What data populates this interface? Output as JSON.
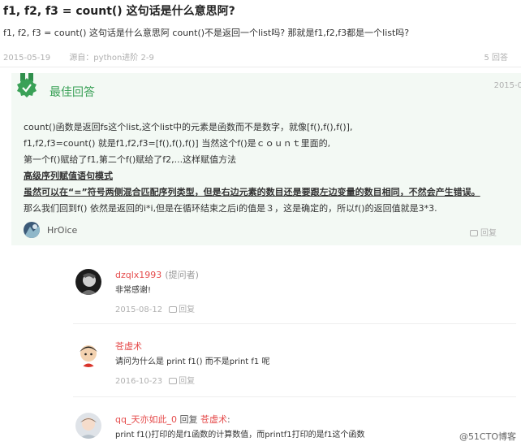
{
  "question": {
    "title": "f1, f2, f3 = count() 这句话是什么意思阿?",
    "description": "f1, f2, f3 = count() 这句话是什么意思阿   count()不是返回一个list吗?   那就是f1,f2,f3都是一个list吗?",
    "date": "2015-05-19",
    "source": "源自：python进阶 2-9",
    "answer_count": "5 回答"
  },
  "best_answer": {
    "label": "最佳回答",
    "date": "2015-0",
    "lines": [
      "count()函数是返回fs这个list,这个list中的元素是函数而不是数字，就像[f(),f(),f()],",
      "f1,f2,f3=count()  就是f1,f2,f3=[f(),f(),f()]    当然这个f()是ｃｏｕｎｔ里面的,",
      "第一个f()赋给了f1,第二个f()赋给了f2,...这样赋值方法",
      "高级序列赋值语句模式",
      "虽然可以在“=”符号两侧混合匹配序列类型，但是右边元素的数目还是要跟左边变量的数目相同，不然会产生错误。",
      "那么我们回到f()        依然是返回的i*i,但是在循环结束之后i的值是３，这是确定的，所以f()的返回值就是3*3."
    ],
    "user": "HrOice",
    "reply_label": "回复"
  },
  "comments": [
    {
      "name": "dzqlx1993",
      "role": "(提问者)",
      "text": "非常感谢!",
      "date": "2015-08-12",
      "reply_label": "回复"
    },
    {
      "name": "苍虚术",
      "text": "请问为什么是 print f1() 而不是print f1 呢",
      "date": "2016-10-23",
      "reply_label": "回复"
    },
    {
      "name": "qq_天亦如此_0",
      "reply_word": "回复",
      "reply_to": "苍虚术",
      "colon": ":",
      "text": "print f1()打印的是f1函数的计算数值，而printf1打印的是f1这个函数"
    }
  ],
  "watermark": "@51CTO博客",
  "colors": {
    "accent_green": "#3aa157",
    "best_bg": "#f3f9f4",
    "username_red": "#e54b4b",
    "meta_gray": "#b0b0b0"
  },
  "icons": [
    "best-answer-badge-icon",
    "reply-icon",
    "avatar-hroice",
    "avatar-dzqlx1993",
    "avatar-cangxushu",
    "avatar-qq-tianyiruci"
  ]
}
